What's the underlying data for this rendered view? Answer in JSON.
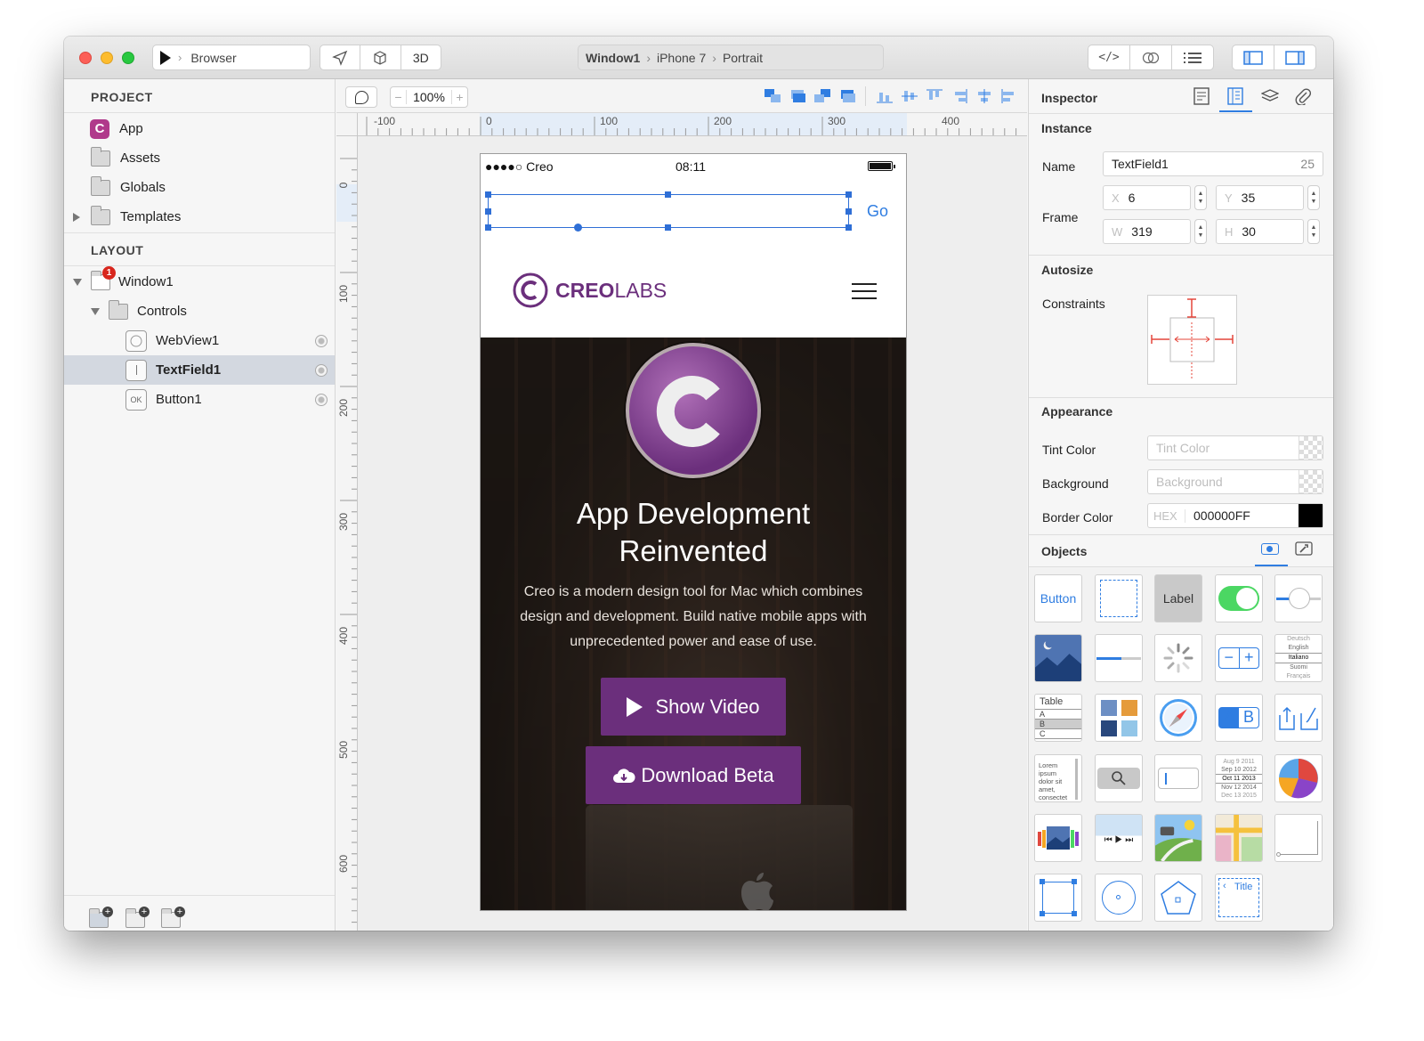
{
  "toolbar": {
    "scheme_label": "Browser",
    "mode_3d": "3D",
    "breadcrumb": [
      "Window1",
      "iPhone 7",
      "Portrait"
    ]
  },
  "project": {
    "header": "PROJECT",
    "items": [
      {
        "label": "App",
        "icon": "app-icon"
      },
      {
        "label": "Assets",
        "icon": "folder-icon"
      },
      {
        "label": "Globals",
        "icon": "folder-icon"
      },
      {
        "label": "Templates",
        "icon": "folder-icon"
      }
    ]
  },
  "layout": {
    "header": "LAYOUT",
    "window": {
      "label": "Window1",
      "badge": "1"
    },
    "controls": {
      "label": "Controls"
    },
    "children": [
      {
        "label": "WebView1",
        "icon": "compass-icon"
      },
      {
        "label": "TextField1",
        "icon": "textfield-icon"
      },
      {
        "label": "Button1",
        "icon": "ok-button-icon",
        "glyph": "OK"
      }
    ],
    "selected": "TextField1"
  },
  "canvas": {
    "zoom": "100%",
    "hruler_labels": [
      "-100",
      "0",
      "100",
      "200",
      "300",
      "400"
    ],
    "vruler_labels": [
      "0",
      "100",
      "200",
      "300",
      "400",
      "500",
      "600"
    ]
  },
  "phone": {
    "carrier": "●●●●○ Creo",
    "time": "08:11",
    "go_label": "Go",
    "brand_bold": "CREO",
    "brand_light": "LABS",
    "hero_title_line1": "App Development",
    "hero_title_line2": "Reinvented",
    "hero_body_line1": "Creo is a modern design tool for Mac which combines",
    "hero_body_line2": "design and development. Build native mobile apps with",
    "hero_body_line3": "unprecedented power and ease of use.",
    "show_video": "Show Video",
    "download_beta": "Download Beta",
    "accent_color": "#6b2f7c"
  },
  "inspector": {
    "title": "Inspector",
    "instance_header": "Instance",
    "name_label": "Name",
    "name_value": "TextField1",
    "name_count": "25",
    "frame_label": "Frame",
    "x_ph": "X",
    "x_value": "6",
    "y_ph": "Y",
    "y_value": "35",
    "w_ph": "W",
    "w_value": "319",
    "h_ph": "H",
    "h_value": "30",
    "autosize_header": "Autosize",
    "constraints_label": "Constraints",
    "appearance_header": "Appearance",
    "tint_label": "Tint Color",
    "tint_placeholder": "Tint Color",
    "background_label": "Background",
    "background_placeholder": "Background",
    "border_label": "Border Color",
    "hex_ph": "HEX",
    "border_value": "000000FF",
    "objects_header": "Objects"
  },
  "objects": {
    "button_label": "Button",
    "label_label": "Label",
    "table_label": "Table",
    "table_rows": [
      "A",
      "B",
      "C"
    ],
    "ab_label": "AB",
    "picker_items": [
      "Deutsch",
      "English",
      "Italiano",
      "Suomi",
      "Français"
    ],
    "lorem": "Lorem ipsum dolor sit amet, consectet",
    "date_rows": [
      "Aug 9 2011",
      "Sep 10 2012",
      "Oct 11 2013",
      "Nov 12 2014",
      "Dec 13 2015"
    ],
    "nav_title": "Title"
  }
}
